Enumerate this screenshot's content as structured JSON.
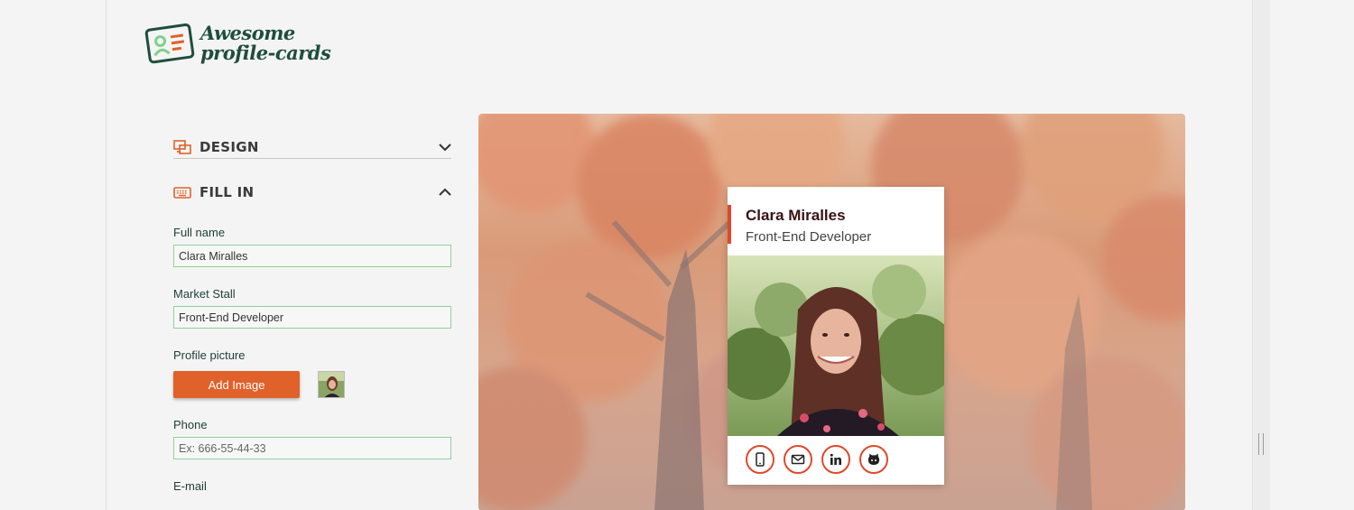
{
  "app": {
    "logo_text_line1": "Awesome",
    "logo_text_line2": "profile-cards"
  },
  "panel": {
    "design_label": "DESIGN",
    "fill_label": "FILL IN",
    "fields": {
      "full_name_label": "Full name",
      "full_name_value": "Clara Miralles",
      "job_label": "Market Stall",
      "job_value": "Front-End Developer",
      "picture_label": "Profile picture",
      "add_image_label": "Add Image",
      "phone_label": "Phone",
      "phone_placeholder": "Ex: 666-55-44-33",
      "email_label": "E-mail"
    }
  },
  "card": {
    "name": "Clara Miralles",
    "job": "Front-End Developer",
    "social_icons": [
      "mobile-icon",
      "email-icon",
      "linkedin-icon",
      "github-icon"
    ]
  },
  "colors": {
    "accent": "#e0612a",
    "card_bar": "#e0482a",
    "logo": "#1f4d3e",
    "input_border": "#8fd19b"
  }
}
